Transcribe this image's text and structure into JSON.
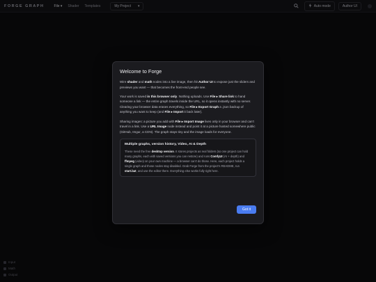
{
  "topbar": {
    "brand": "FORGE GRAPH",
    "menu": [
      "File ▾",
      "Shader",
      "Templates"
    ],
    "project_name": "My Project",
    "project_caret": "▾",
    "actions": {
      "mode_label": "Auto mode",
      "author_label": "Author UI"
    },
    "icons": [
      "search-icon",
      "bolt-icon",
      "user-icon"
    ]
  },
  "legend": {
    "items": [
      "Input",
      "Math",
      "Output"
    ]
  },
  "modal": {
    "title": "Welcome to Forge",
    "p1": [
      {
        "t": "Wire "
      },
      {
        "b": "shader"
      },
      {
        "t": " and "
      },
      {
        "b": "math"
      },
      {
        "t": " nodes into a live image, then hit "
      },
      {
        "b": "Author UI"
      },
      {
        "t": " to expose just the sliders and previews you want — that becomes the front-end people see."
      }
    ],
    "p2": [
      {
        "t": "Your work is saved "
      },
      {
        "b": "in this browser only"
      },
      {
        "t": ". Nothing uploads. Use "
      },
      {
        "b": "File ▸ Share link"
      },
      {
        "t": " to hand someone a link — the entire graph travels inside the URL, so it opens instantly with no server. Clearing your browser data erases everything, so "
      },
      {
        "b": "File ▸ Export Graph"
      },
      {
        "t": " a .json backup of anything you want to keep (and "
      },
      {
        "b": "File ▸ Import"
      },
      {
        "t": " it back later)."
      }
    ],
    "p3": [
      {
        "t": "Sharing images: a picture you add with "
      },
      {
        "b": "File ▸ Import Image"
      },
      {
        "t": " lives only in your browser and can't travel in a link. Use a "
      },
      {
        "b": "URL Image"
      },
      {
        "t": " node instead and point it at a picture hosted somewhere public (GitHub, Imgur, a CDN). The graph stays tiny and the image loads for everyone."
      }
    ],
    "box_title": "Multiple graphs, version history, Video, AI & Depth",
    "box_text": [
      {
        "t": "These need the free "
      },
      {
        "b": "desktop version"
      },
      {
        "t": ". It stores projects as real folders (so one project can hold many graphs, each with saved versions you can restore) and runs "
      },
      {
        "b": "ComfyUI"
      },
      {
        "t": " (AI + depth) and "
      },
      {
        "b": "ffmpeg"
      },
      {
        "t": " (video) on your own machine — a browser can't do those. Here, each project holds a single graph and those nodes stay disabled. Grab Forge from the project's README, run "
      },
      {
        "b": "start.bat"
      },
      {
        "t": ", and use the editor there. Everything else works fully right here."
      }
    ],
    "button_label": "Got it"
  }
}
